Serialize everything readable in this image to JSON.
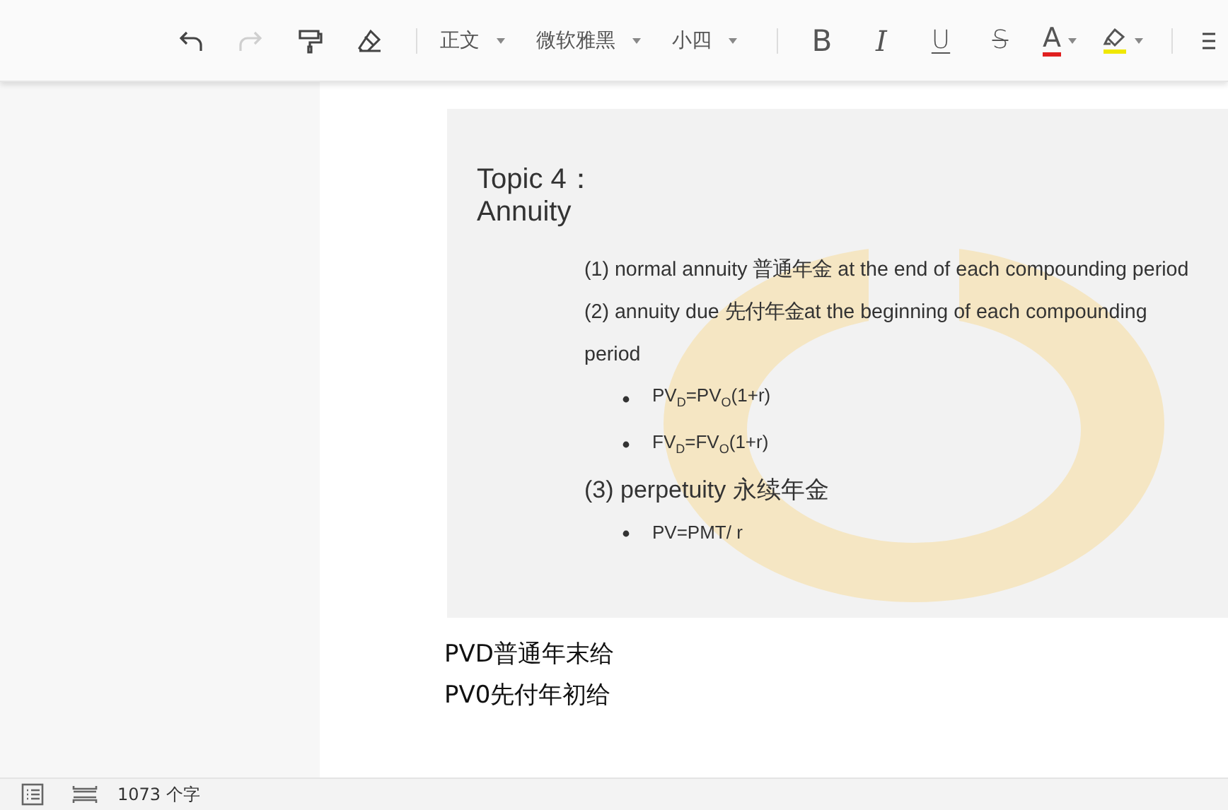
{
  "toolbar": {
    "items": [
      {
        "kind": "undo",
        "disabled": false
      },
      {
        "kind": "redo",
        "disabled": true
      },
      {
        "kind": "painter",
        "disabled": false
      },
      {
        "kind": "eraser",
        "disabled": false
      },
      {
        "kind": "separator"
      },
      {
        "kind": "dropdown",
        "label": "正文"
      },
      {
        "kind": "dropdown",
        "label": "微软雅黑"
      },
      {
        "kind": "dropdown",
        "label": "小四"
      },
      {
        "kind": "separator"
      },
      {
        "kind": "bold",
        "label": "B"
      },
      {
        "kind": "italic",
        "label": "I"
      },
      {
        "kind": "underline",
        "label": "U"
      },
      {
        "kind": "strike",
        "label": "S"
      },
      {
        "kind": "color",
        "label": "A",
        "color": "#e02020"
      },
      {
        "kind": "highlight",
        "color": "#f0e800"
      },
      {
        "kind": "separator"
      },
      {
        "kind": "list"
      }
    ]
  },
  "document": {
    "slide": {
      "title": [
        "Topic 4：",
        "Annuity"
      ],
      "items": [
        {
          "kind": "point",
          "text": "(1) normal annuity 普通年金 at the end of each compounding period"
        },
        {
          "kind": "point",
          "text": "(2) annuity due 先付年金at the beginning of each compounding period"
        },
        {
          "kind": "bullet",
          "text": "PV$_{D}$=PV$_{O}$(1+r)"
        },
        {
          "kind": "bullet",
          "text": "FV$_{D}$=FV$_{O}$(1+r)"
        },
        {
          "kind": "heading",
          "text": "(3) perpetuity 永续年金"
        },
        {
          "kind": "bullet",
          "text": "PV=PMT/ r"
        }
      ]
    },
    "lines_after": [
      "PVD普通年末给",
      "PV0先付年初给"
    ]
  },
  "status_bar": {
    "word_count": "1073 个字"
  }
}
